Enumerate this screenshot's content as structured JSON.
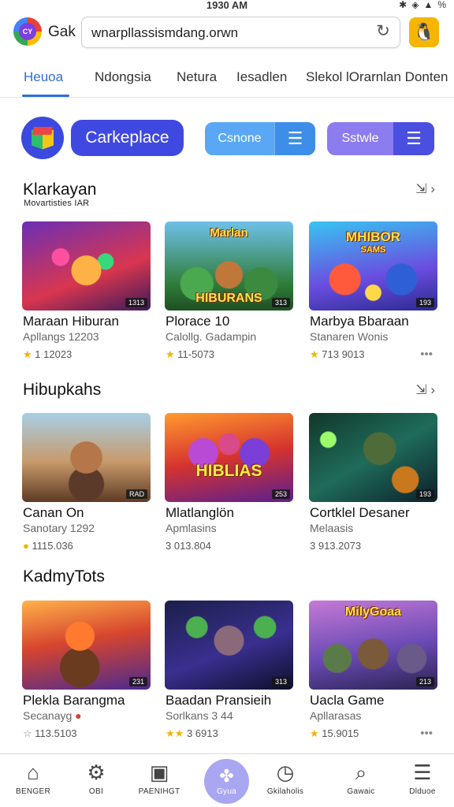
{
  "status": {
    "time": "1930 AM",
    "battery": "%"
  },
  "browser": {
    "app_logo": "CY",
    "app_name": "Gak",
    "url": "wnarpllassismdang.orwn",
    "reload_icon": "reload-icon",
    "profile_icon": "penguin-icon"
  },
  "tabs": [
    {
      "label": "Heuoa",
      "active": true
    },
    {
      "label": "Ndongsia"
    },
    {
      "label": "Netura"
    },
    {
      "label": "Iesadlen"
    },
    {
      "label": "Slekol lOrarnlan Donten"
    }
  ],
  "actions": {
    "marketplace_label": "Carkeplace",
    "segment_blue_label": "Csnone",
    "segment_purple_label": "Sstwle"
  },
  "sections": [
    {
      "title": "Klarkayan",
      "subtitle": "Movartisties IAR",
      "items": [
        {
          "title": "Maraan Hiburan",
          "sub": "Apllangs 12203",
          "meta": "1 12023",
          "rating_icon": "star",
          "badge": "1313"
        },
        {
          "title": "Plorace 10",
          "sub": "Calollg. Gadampin",
          "meta": "11-5073",
          "rating_icon": "star",
          "badge": "313",
          "banner": "Marlan HIBURANS"
        },
        {
          "title": "Marbya Bbaraan",
          "sub": "Stanaren Wonis",
          "meta": "713 9013",
          "rating_icon": "star",
          "badge": "193",
          "banner": "MHIBOR SAMS"
        }
      ]
    },
    {
      "title": "Hibupkahs",
      "subtitle": "",
      "items": [
        {
          "title": "Canan On",
          "sub": "Sanotary 1292",
          "meta": "1115.036",
          "rating_icon": "dot",
          "badge": "RAD"
        },
        {
          "title": "Mlatlanglön",
          "sub": "Apmlasins",
          "meta": "3 013.804",
          "rating_icon": "none",
          "badge": "253",
          "banner": "HIBLIAS"
        },
        {
          "title": "Cortklel Desaner",
          "sub": "Melaasis",
          "meta": "3 913.2073",
          "rating_icon": "none",
          "badge": "193"
        }
      ]
    },
    {
      "title": "KadmyTots",
      "subtitle": "",
      "items": [
        {
          "title": "Plekla Barangma",
          "sub": "Secanayg",
          "meta": "113.5103",
          "rating_icon": "outline",
          "badge": "231"
        },
        {
          "title": "Baadan Pransieih",
          "sub": "Sorlkans 3 44",
          "meta": "3 6913",
          "rating_icon": "stars2",
          "badge": "313"
        },
        {
          "title": "Uacla Game",
          "sub": "Apllarasas",
          "meta": "15.9015",
          "rating_icon": "star",
          "badge": "213",
          "banner": "MilyGoaa"
        }
      ]
    }
  ],
  "bottom_nav": [
    {
      "label": "BENGER",
      "icon": "home-icon"
    },
    {
      "label": "OBI",
      "icon": "settings-icon"
    },
    {
      "label": "PAENIHGT",
      "icon": "gallery-icon"
    },
    {
      "label": "Gyua",
      "icon": "apps-icon"
    },
    {
      "label": "Gkilaholis",
      "icon": "clock-icon"
    },
    {
      "label": "Gawaic",
      "icon": "search-icon"
    },
    {
      "label": "Dlduoe",
      "icon": "menu-icon"
    }
  ]
}
